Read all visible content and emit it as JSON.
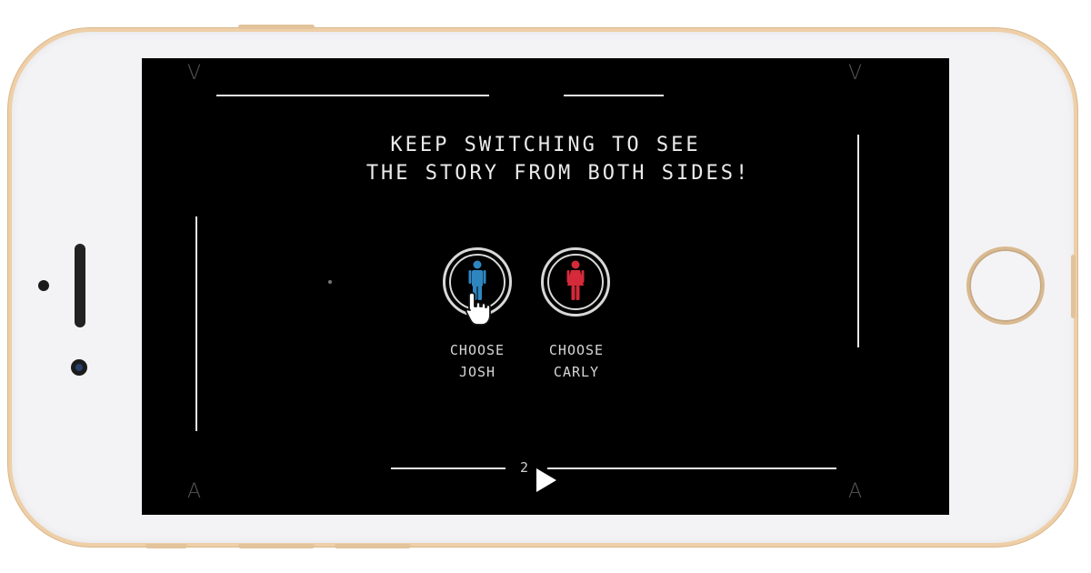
{
  "screen": {
    "headline_line1": "KEEP SWITCHING TO SEE",
    "headline_line2": "THE STORY FROM BOTH SIDES!",
    "choices": [
      {
        "label_line1": "CHOOSE",
        "label_line2": "JOSH",
        "icon": "male-figure-icon",
        "color": "#2e86c1"
      },
      {
        "label_line1": "CHOOSE",
        "label_line2": "CARLY",
        "icon": "female-figure-icon",
        "color": "#d42a3a"
      }
    ],
    "page_number": "2",
    "corner_marks": {
      "top_left": "V",
      "top_right": "V",
      "bottom_left": "A",
      "bottom_right": "A"
    }
  },
  "colors": {
    "phone_gold": "#eecfa8",
    "screen_bg": "#000000",
    "line": "#e8e8e8"
  }
}
